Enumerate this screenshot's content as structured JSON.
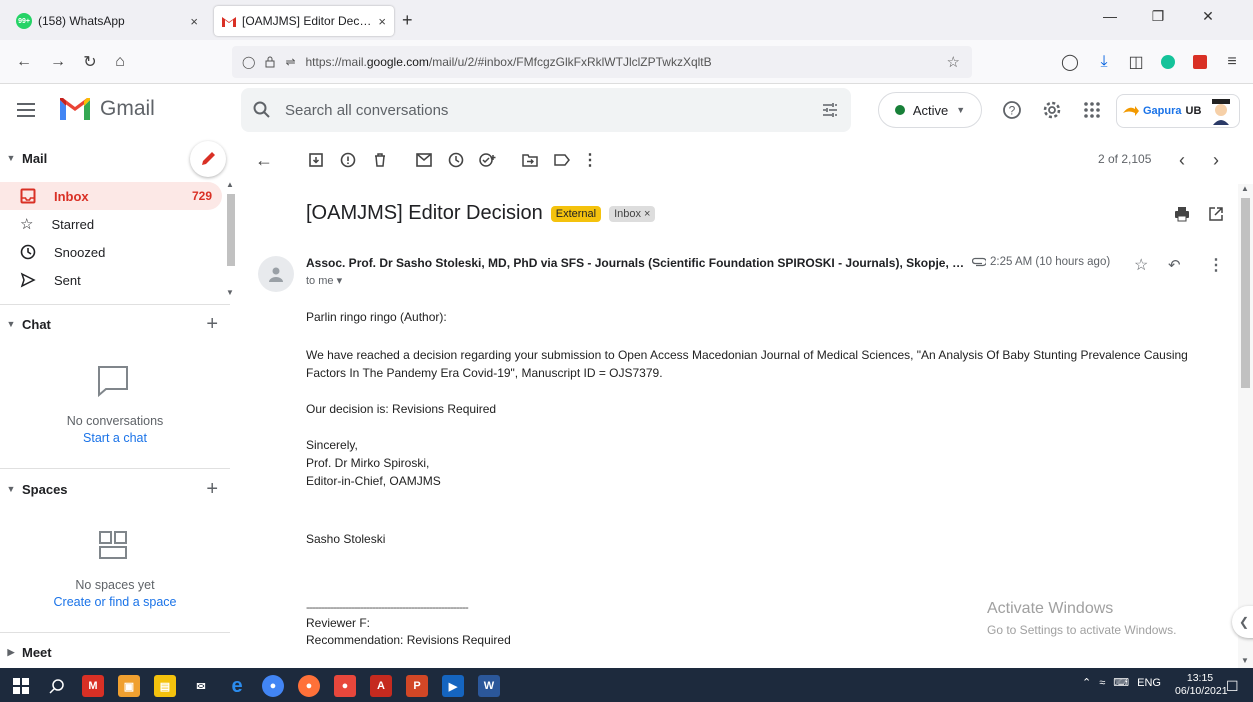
{
  "browser": {
    "tabs": [
      {
        "title": "(158) WhatsApp",
        "badge": "99+",
        "close": "×"
      },
      {
        "title": "[OAMJMS] Editor Decision - go",
        "close": "×"
      }
    ],
    "new_tab": "+",
    "url_prefix": "https://mail.",
    "url_domain": "google.com",
    "url_path": "/mail/u/2/#inbox/FMfcgzGlkFxRklWTJlclZPTwkzXqltB"
  },
  "gmail": {
    "logo_text": "Gmail",
    "search_placeholder": "Search all conversations",
    "status": "Active",
    "account_badge": {
      "part1": "Gapura",
      "part2": "UB"
    }
  },
  "sidebar": {
    "mail_header": "Mail",
    "items": [
      {
        "label": "Inbox",
        "count": "729",
        "icon": "inbox-icon"
      },
      {
        "label": "Starred",
        "icon": "star-icon"
      },
      {
        "label": "Snoozed",
        "icon": "clock-icon"
      },
      {
        "label": "Sent",
        "icon": "send-icon"
      }
    ],
    "chat_header": "Chat",
    "chat_empty": "No conversations",
    "chat_link": "Start a chat",
    "spaces_header": "Spaces",
    "spaces_empty": "No spaces yet",
    "spaces_link": "Create or find a space",
    "meet_header": "Meet"
  },
  "toolbar": {
    "pager": "2 of 2,105"
  },
  "message": {
    "subject": "[OAMJMS] Editor Decision",
    "label_external": "External",
    "label_inbox": "Inbox ×",
    "sender": "Assoc. Prof. Dr Sasho Stoleski, MD, PhD via SFS - Journals (Scientific Foundation SPIROSKI - Journals), Skopje, Republic of Macedonia",
    "recipient": "to me ▾",
    "time": "2:25 AM (10 hours ago)",
    "body": {
      "greeting": "Parlin ringo ringo (Author):",
      "p1_line1": "We have reached a decision regarding your submission to Open Access Macedonian Journal of Medical Sciences, \"An Analysis Of Baby Stunting Prevalence Causing",
      "p1_line2": "Factors In The Pandemy Era Covid-19\", Manuscript ID = OJS7379.",
      "decision": "Our decision is: Revisions Required",
      "sign1": "Sincerely,",
      "sign2": "Prof. Dr Mirko Spiroski,",
      "sign3": "Editor-in-Chief, OAMJMS",
      "sign4": "Sasho Stoleski",
      "separator": "------------------------------------------------------",
      "reviewer": "Reviewer F:",
      "recommendation": "Recommendation: Revisions Required"
    }
  },
  "watermark": {
    "line1": "Activate Windows",
    "line2": "Go to Settings to activate Windows."
  },
  "taskbar": {
    "lang": "ENG",
    "time": "13:15",
    "date": "06/10/2021"
  },
  "colors": {
    "gmail_red": "#d93025",
    "inbox_bg": "#fce8e6",
    "external_label": "#f4c20d",
    "link_blue": "#1a73e8",
    "taskbar": "#1d2a3d"
  }
}
